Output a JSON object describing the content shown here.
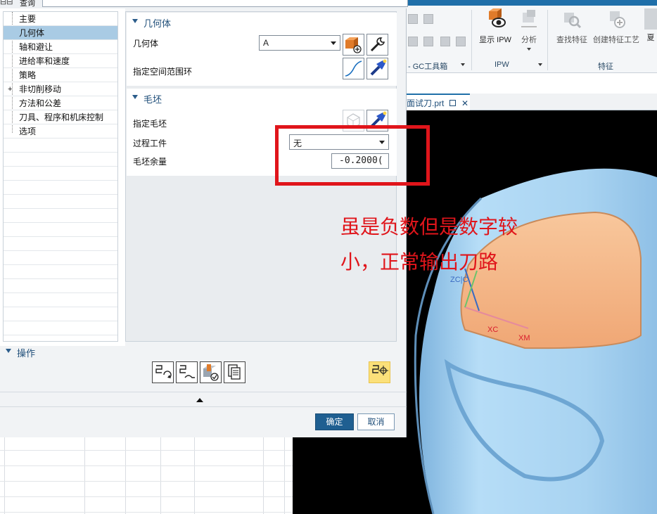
{
  "navigator": {
    "query_label": "查询",
    "tree_items": [
      {
        "label": "主要",
        "selected": false
      },
      {
        "label": "几何体",
        "selected": true
      },
      {
        "label": "轴和避让",
        "selected": false
      },
      {
        "label": "进给率和速度",
        "selected": false
      },
      {
        "label": "策略",
        "selected": false
      },
      {
        "label": "非切削移动",
        "selected": false,
        "expandable": true
      },
      {
        "label": "方法和公差",
        "selected": false
      },
      {
        "label": "刀具、程序和机床控制",
        "selected": false
      },
      {
        "label": "选项",
        "selected": false
      }
    ]
  },
  "geometry_section": {
    "title": "几何体",
    "geometry_label": "几何体",
    "geometry_value": "A",
    "spatial_range_label": "指定空间范围环"
  },
  "blank_section": {
    "title": "毛坯",
    "specify_blank_label": "指定毛坯",
    "process_workpiece_label": "过程工件",
    "process_workpiece_value": "无",
    "blank_allowance_label": "毛坯余量",
    "blank_allowance_value": "-0.2000("
  },
  "operations": {
    "title": "操作"
  },
  "footer": {
    "ok_label": "确定",
    "cancel_label": "取消"
  },
  "ribbon": {
    "groups": [
      {
        "label": "- GC工具箱"
      },
      {
        "label": "IPW"
      },
      {
        "label": "特征"
      }
    ],
    "buttons": {
      "show_ipw": "显示 IPW",
      "analyze": "分析",
      "find_feature": "查找特征",
      "create_feature_process": "创建特征工艺",
      "partial": "夏"
    }
  },
  "file_tab": {
    "label": "面试刀.prt"
  },
  "viewport_labels": {
    "zc": "ZC|C",
    "xc": "XC",
    "xm": "XM"
  },
  "annotation": {
    "line1": "虽是负数但是数字较",
    "line2": "小，正常输出刀路"
  },
  "colors": {
    "accent": "#1f6fa9",
    "selected_row": "#a9cbe4",
    "annotation_red": "#e0151b",
    "part_blue": "#9fcdf0",
    "cut_orange": "#f5b98a"
  }
}
